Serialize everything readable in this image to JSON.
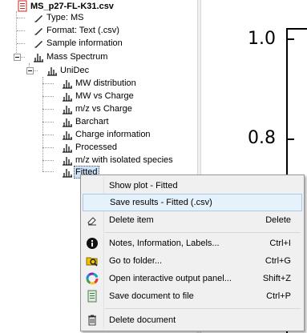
{
  "tree": {
    "document": "MS_p27-FL-K31.csv",
    "items": [
      {
        "label": "Type: MS",
        "icon": "pencil-icon"
      },
      {
        "label": "Format: Text (.csv)",
        "icon": "pencil-icon"
      },
      {
        "label": "Sample information",
        "icon": "pencil-icon"
      },
      {
        "label": "Mass Spectrum",
        "icon": "spectrum-icon"
      },
      {
        "label": "UniDec",
        "icon": "spectrum-icon"
      },
      {
        "label": "MW distribution",
        "icon": "spectrum-icon"
      },
      {
        "label": "MW vs Charge",
        "icon": "spectrum-icon"
      },
      {
        "label": "m/z vs Charge",
        "icon": "spectrum-icon"
      },
      {
        "label": "Barchart",
        "icon": "spectrum-icon"
      },
      {
        "label": "Charge information",
        "icon": "spectrum-icon"
      },
      {
        "label": "Processed",
        "icon": "spectrum-icon"
      },
      {
        "label": "m/z with isolated species",
        "icon": "spectrum-icon"
      },
      {
        "label": "Fitted",
        "icon": "spectrum-icon"
      }
    ]
  },
  "plot": {
    "ytick_top": "1.0",
    "ytick_mid": "0.8"
  },
  "menu": {
    "items": [
      {
        "label": "Show plot - Fitted",
        "shortcut": ""
      },
      {
        "label": "Save results - Fitted (.csv)",
        "shortcut": ""
      },
      {
        "label": "Delete item",
        "shortcut": "Delete"
      },
      {
        "label": "Notes, Information, Labels...",
        "shortcut": "Ctrl+I"
      },
      {
        "label": "Go to folder...",
        "shortcut": "Ctrl+G"
      },
      {
        "label": "Open interactive output panel...",
        "shortcut": "Shift+Z"
      },
      {
        "label": "Save document to file",
        "shortcut": "Ctrl+P"
      },
      {
        "label": "Delete document",
        "shortcut": ""
      }
    ]
  },
  "colors": {
    "selection": "#cde2f7",
    "menu_bg": "#f0f0f0",
    "menu_highlight": "#e5f1fb",
    "doc_icon": "#cc2222"
  }
}
